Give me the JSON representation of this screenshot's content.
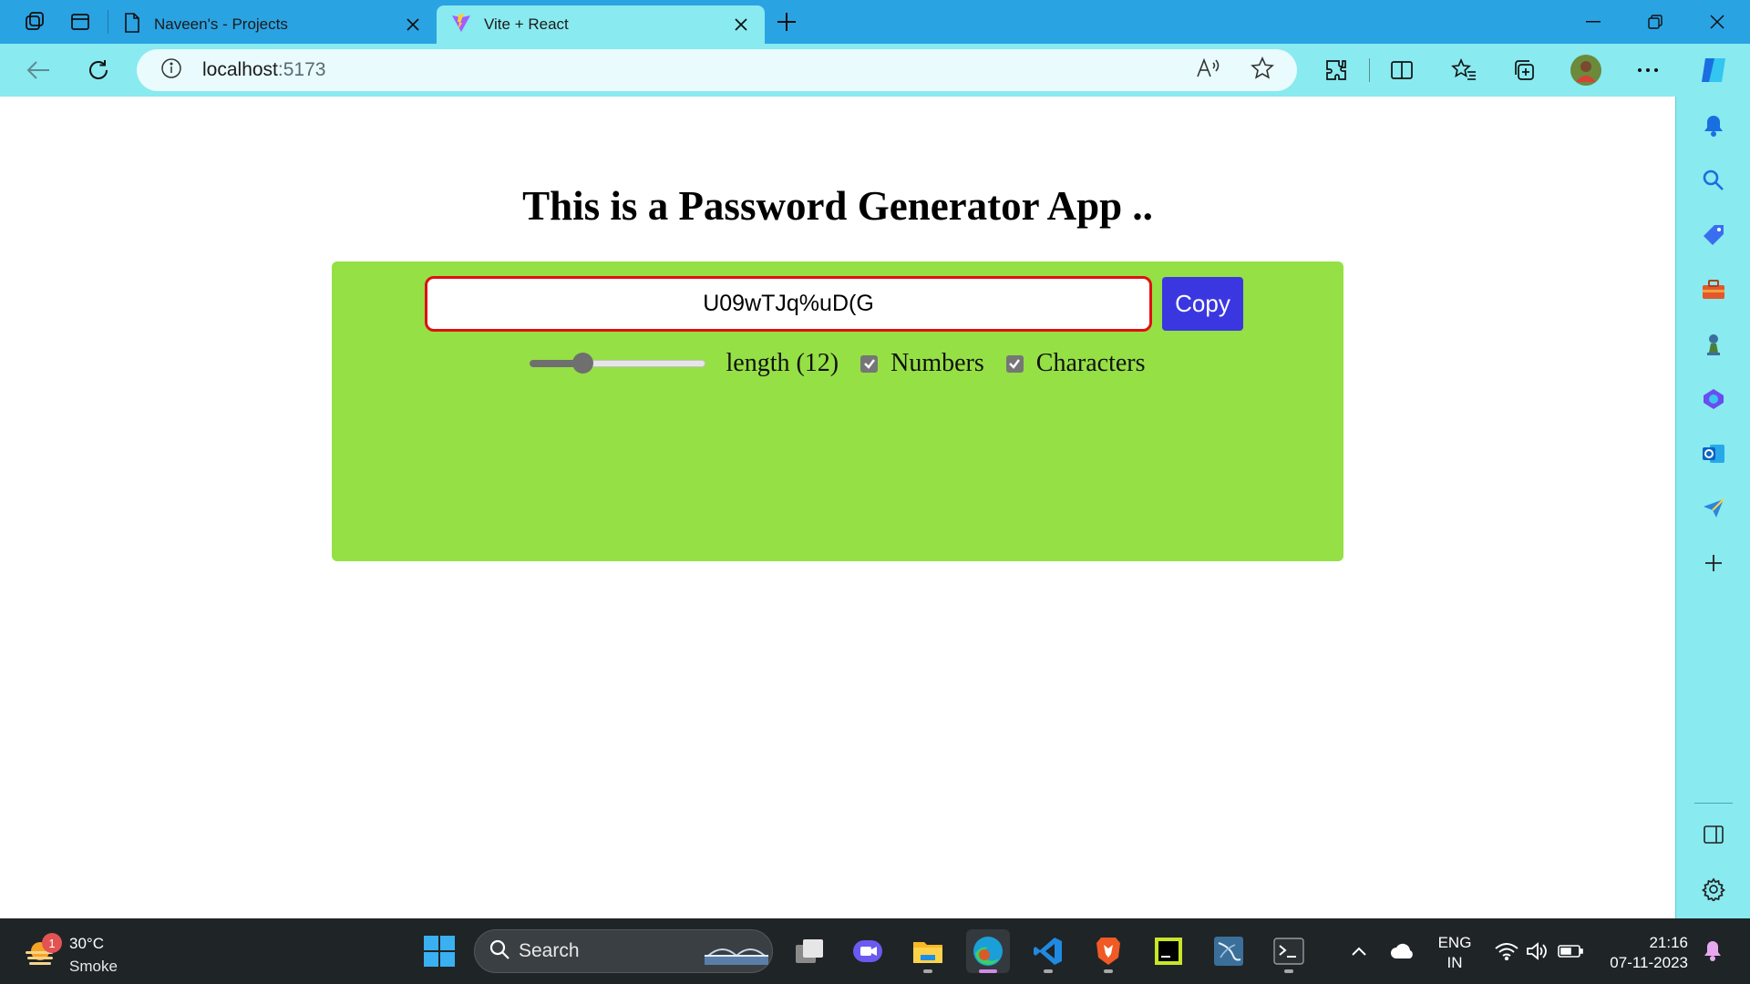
{
  "browser": {
    "tabs": [
      {
        "title": "Naveen's - Projects",
        "active": false,
        "icon": "document-icon"
      },
      {
        "title": "Vite + React",
        "active": true,
        "icon": "vite-logo-icon"
      }
    ],
    "address": {
      "host": "localhost",
      "port": ":5173"
    },
    "colors": {
      "tabstrip": "#2aa3e3",
      "toolbar": "#89eaf0"
    }
  },
  "app": {
    "heading": "This is a Password Generator App ..",
    "password": "U09wTJq%uD(G",
    "copy_label": "Copy",
    "length_label": "length (12)",
    "length_value": 12,
    "length_slider_fraction": 0.3,
    "numbers_label": "Numbers",
    "numbers_checked": true,
    "characters_label": "Characters",
    "characters_checked": true,
    "colors": {
      "card": "#95e045",
      "copy_button": "#3b37e0",
      "input_border": "#e01010"
    }
  },
  "sidebar": {
    "items": [
      "bell-icon",
      "search-icon",
      "tag-icon",
      "toolbox-icon",
      "chess-icon",
      "copilot-icon",
      "outlook-icon",
      "send-icon",
      "add-icon"
    ],
    "bottom": [
      "panel-icon",
      "settings-icon"
    ]
  },
  "taskbar": {
    "weather": {
      "temp": "30°C",
      "condition": "Smoke",
      "badge": "1"
    },
    "search_placeholder": "Search",
    "language": {
      "line1": "ENG",
      "line2": "IN"
    },
    "time": "21:16",
    "date": "07-11-2023"
  }
}
